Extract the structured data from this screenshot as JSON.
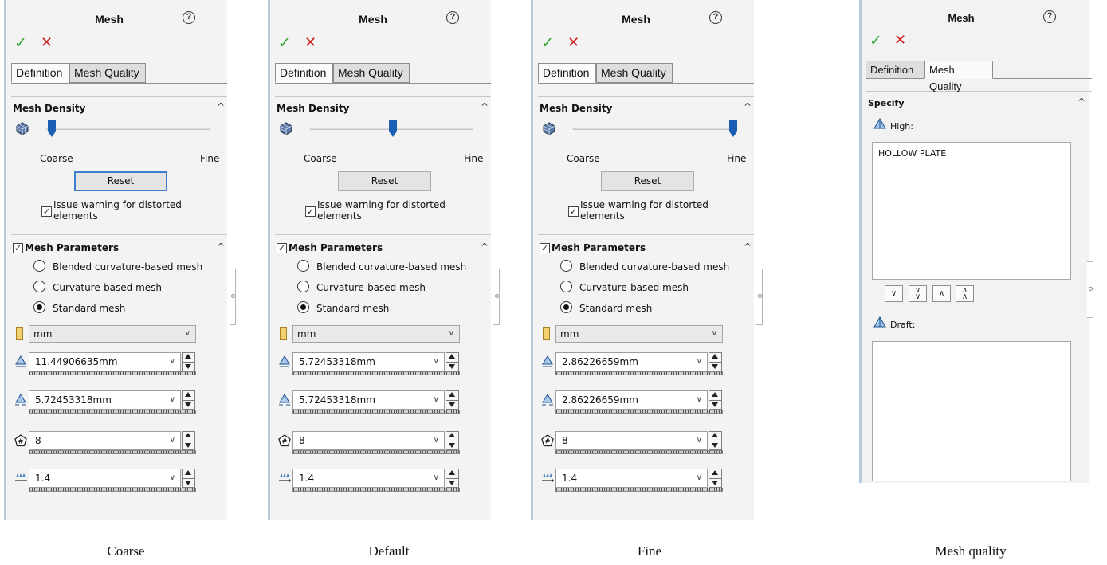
{
  "panels": [
    {
      "title": "Mesh",
      "help": "?",
      "ok": "✓",
      "cancel": "✕",
      "tabs": {
        "definition": "Definition",
        "mesh_quality": "Mesh Quality"
      },
      "mesh_density": {
        "label": "Mesh Density",
        "slider_level": 0.0,
        "coarse": "Coarse",
        "fine": "Fine",
        "reset": "Reset",
        "reset_focused": true,
        "warning_checked": true,
        "warning_label": "Issue warning for distorted elements"
      },
      "mesh_parameters": {
        "checked": true,
        "label": "Mesh Parameters",
        "options": [
          "Blended curvature-based mesh",
          "Curvature-based mesh",
          "Standard mesh"
        ],
        "selected": 2,
        "unit": "mm",
        "global_size": "11.44906635mm",
        "tolerance": "5.72453318mm",
        "jacobian": "8",
        "ratio": "1.4"
      },
      "caption": "Coarse"
    },
    {
      "title": "Mesh",
      "help": "?",
      "ok": "✓",
      "cancel": "✕",
      "tabs": {
        "definition": "Definition",
        "mesh_quality": "Mesh Quality"
      },
      "mesh_density": {
        "label": "Mesh Density",
        "slider_level": 0.5,
        "coarse": "Coarse",
        "fine": "Fine",
        "reset": "Reset",
        "reset_focused": false,
        "warning_checked": true,
        "warning_label": "Issue warning for distorted elements"
      },
      "mesh_parameters": {
        "checked": true,
        "label": "Mesh Parameters",
        "options": [
          "Blended curvature-based mesh",
          "Curvature-based mesh",
          "Standard mesh"
        ],
        "selected": 2,
        "unit": "mm",
        "global_size": "5.72453318mm",
        "tolerance": "5.72453318mm",
        "jacobian": "8",
        "ratio": "1.4"
      },
      "caption": "Default"
    },
    {
      "title": "Mesh",
      "help": "?",
      "ok": "✓",
      "cancel": "✕",
      "tabs": {
        "definition": "Definition",
        "mesh_quality": "Mesh Quality"
      },
      "mesh_density": {
        "label": "Mesh Density",
        "slider_level": 1.0,
        "coarse": "Coarse",
        "fine": "Fine",
        "reset": "Reset",
        "reset_focused": false,
        "warning_checked": true,
        "warning_label": "Issue warning for distorted elements"
      },
      "mesh_parameters": {
        "checked": true,
        "label": "Mesh Parameters",
        "options": [
          "Blended curvature-based mesh",
          "Curvature-based mesh",
          "Standard mesh"
        ],
        "selected": 2,
        "unit": "mm",
        "global_size": "2.86226659mm",
        "tolerance": "2.86226659mm",
        "jacobian": "8",
        "ratio": "1.4"
      },
      "caption": "Fine"
    }
  ],
  "quality_panel": {
    "title": "Mesh",
    "help": "?",
    "ok": "✓",
    "cancel": "✕",
    "tabs": {
      "definition": "Definition",
      "mesh_quality": "Mesh Quality"
    },
    "specify": "Specify",
    "high_label": "High:",
    "high_items": [
      "HOLLOW PLATE"
    ],
    "draft_label": "Draft:",
    "buttons": [
      "move-down",
      "move-to-bottom",
      "move-up",
      "move-to-top"
    ],
    "caption": "Mesh quality"
  },
  "colors": {
    "accent_blue": "#1a5fb4",
    "ok_green": "#2aa52a",
    "cancel_red": "#d21f1f",
    "panel_bg": "#f3f3f3"
  }
}
